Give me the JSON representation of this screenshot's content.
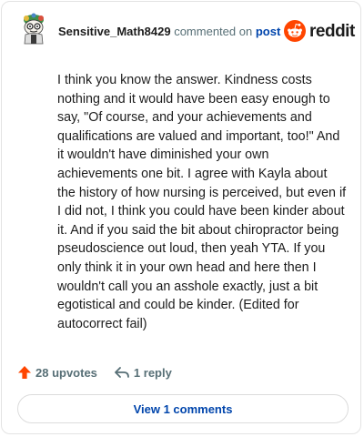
{
  "comment": {
    "username": "Sensitive_Math8429",
    "commented_text": "commented on",
    "post_link_text": "post",
    "body": "I think you know the answer. Kindness costs nothing and it would have been easy enough to say, \"Of course, and your achievements and qualifications are valued and important, too!\" And it wouldn't have diminished your own achievements one bit. I agree with Kayla about the history of how nursing is perceived, but even if I did not, I think you could have been kinder about it. And if you said the bit about chiropractor being pseudoscience out loud, then yeah YTA. If you only think it in your own head and here then I wouldn't call you an asshole exactly, just a bit egotistical and could be kinder. (Edited for autocorrect fail)"
  },
  "brand": {
    "wordmark": "reddit",
    "icon": "reddit-snoo-icon",
    "accent_color": "#ff4500"
  },
  "actions": {
    "upvotes_label": "28 upvotes",
    "reply_label": "1 reply",
    "upvote_icon": "upvote-arrow-icon",
    "reply_icon": "reply-arrow-icon",
    "upvote_color": "#ff4500"
  },
  "footer": {
    "view_comments_label": "View 1 comments",
    "link_color": "#0045ac"
  }
}
